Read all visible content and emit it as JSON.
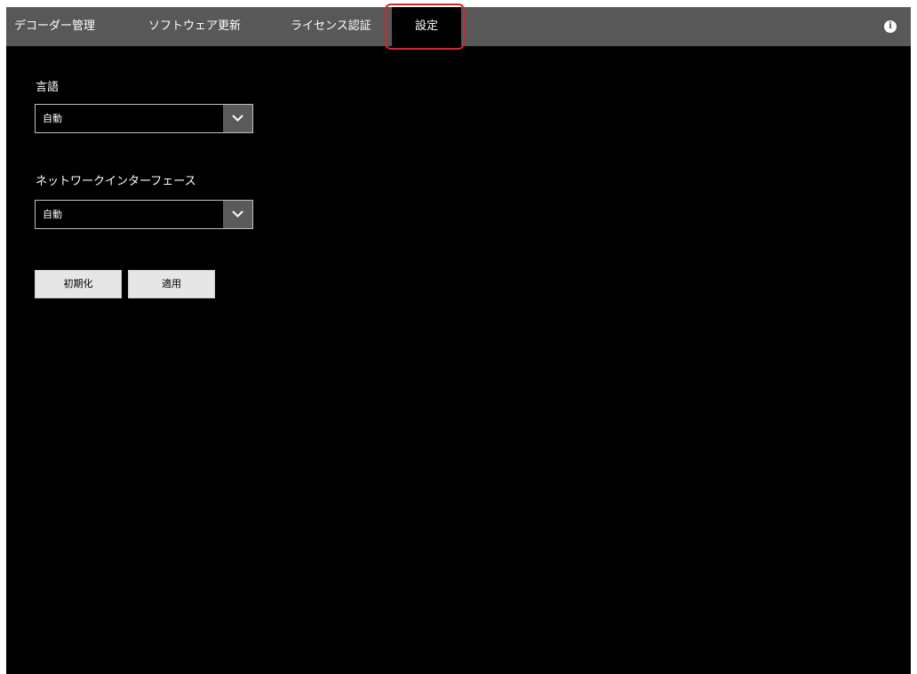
{
  "tabs": [
    {
      "label": "デコーダー管理"
    },
    {
      "label": "ソフトウェア更新"
    },
    {
      "label": "ライセンス認証"
    },
    {
      "label": "設定"
    }
  ],
  "active_tab": "設定",
  "settings": {
    "language": {
      "label": "言語",
      "value": "自動"
    },
    "network_interface": {
      "label": "ネットワークインターフェース",
      "value": "自動"
    }
  },
  "buttons": {
    "reset": "初期化",
    "apply": "適用"
  },
  "icons": {
    "info": "info-icon",
    "dropdown": "chevron-down-icon"
  },
  "colors": {
    "tabbar": "#585858",
    "background": "#000000",
    "highlight": "#d0262e"
  }
}
